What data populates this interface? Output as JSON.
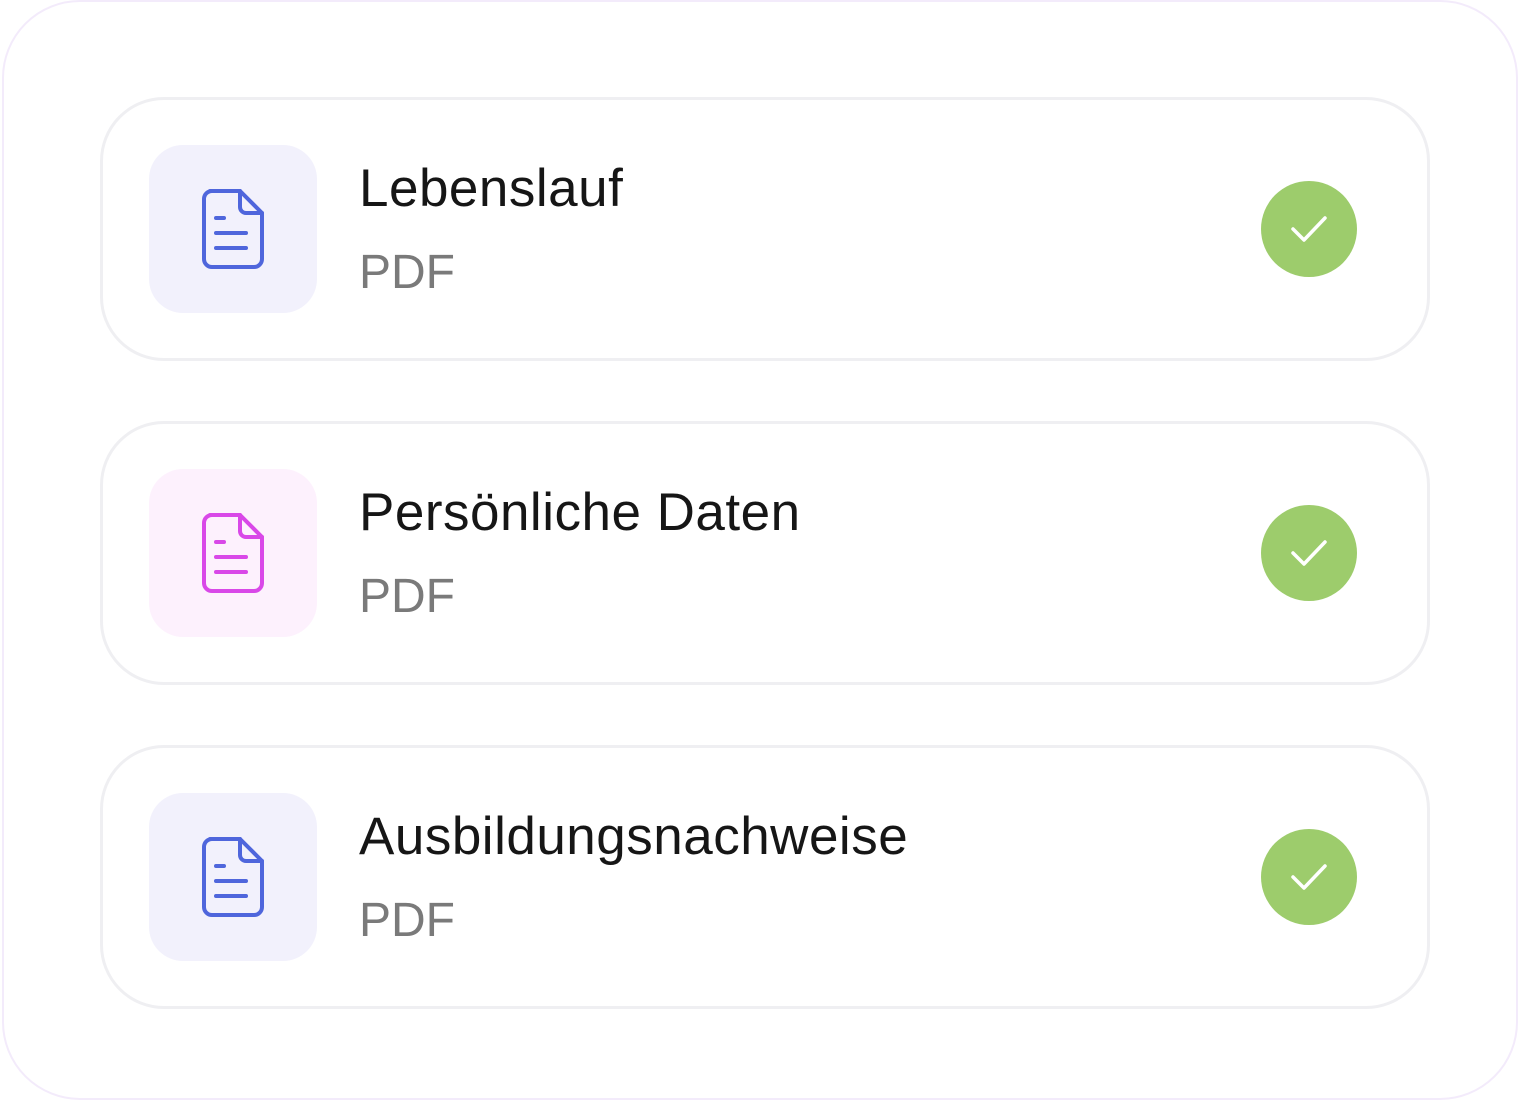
{
  "documents": [
    {
      "title": "Lebenslauf",
      "type": "PDF",
      "icon": "document-icon",
      "icon_color": "#4f66dc",
      "tile_color": "#f2f1fc",
      "status": "check-icon",
      "status_color": "#9dcc6c"
    },
    {
      "title": "Persönliche Daten",
      "type": "PDF",
      "icon": "document-icon",
      "icon_color": "#d948e8",
      "tile_color": "#fdf1fd",
      "status": "check-icon",
      "status_color": "#9dcc6c"
    },
    {
      "title": "Ausbildungsnachweise",
      "type": "PDF",
      "icon": "document-icon",
      "icon_color": "#4f66dc",
      "tile_color": "#f2f1fc",
      "status": "check-icon",
      "status_color": "#9dcc6c"
    }
  ]
}
